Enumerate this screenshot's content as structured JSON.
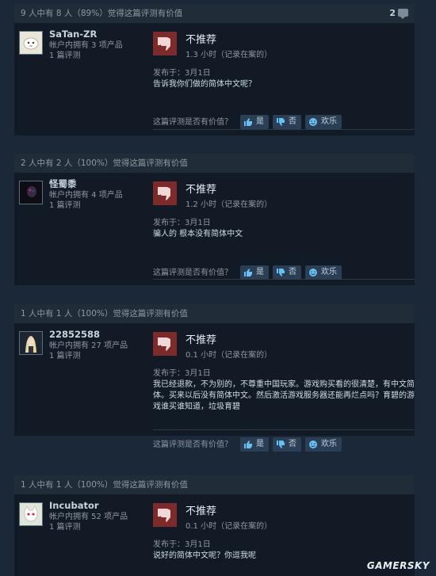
{
  "vote_labels": {
    "yes": "是",
    "no": "否",
    "funny": "欢乐"
  },
  "helpful_question": "这篇评测是否有价值？",
  "reviews": [
    {
      "helpful_summary": "9 人中有 8 人（89%）觉得这篇评测有价值",
      "comment_count": "2",
      "user_name": "SaTan-ZR",
      "products": "帐户内拥有 3 项产品",
      "review_count": "1 篇评测",
      "verdict": "不推荐",
      "hours": "1.3 小时（记录在案的）",
      "posted": "发布于：3月1日",
      "text": "告诉我你们做的简体中文呢？",
      "avatar_icon": "sheep-avatar-icon"
    },
    {
      "helpful_summary": "2 人中有 2 人（100%）觉得这篇评测有价值",
      "comment_count": "",
      "user_name": "怪蜀黍",
      "products": "帐户内拥有 4 项产品",
      "review_count": "1 篇评测",
      "verdict": "不推荐",
      "hours": "1.2 小时（记录在案的）",
      "posted": "发布于：3月1日",
      "text": "骗人的 根本没有简体中文",
      "avatar_icon": "dark-creature-avatar-icon"
    },
    {
      "helpful_summary": "1 人中有 1 人（100%）觉得这篇评测有价值",
      "comment_count": "",
      "user_name": "22852588",
      "products": "帐户内拥有 27 项产品",
      "review_count": "1 篇评测",
      "verdict": "不推荐",
      "hours": "0.1 小时（记录在案的）",
      "posted": "发布于：3月1日",
      "text": "我已经退款，不为别的，不尊重中国玩家。游戏购买看的很清楚，有中文简体。买来以后没有简体中文。然后激活游戏服务器还能再烂点吗？育碧的游戏谁买谁知道，垃圾育碧",
      "avatar_icon": "blonde-character-avatar-icon"
    },
    {
      "helpful_summary": "1 人中有 1 人（100%）觉得这篇评测有价值",
      "comment_count": "",
      "user_name": "Incubator",
      "products": "帐户内拥有 52 项产品",
      "review_count": "1 篇评测",
      "verdict": "不推荐",
      "hours": "0.1 小时（记录在案的）",
      "posted": "发布于：3月1日",
      "text": "说好的简体中文呢？你逗我呢",
      "avatar_icon": "white-cat-avatar-icon"
    }
  ],
  "watermark": "GAMERSKY",
  "colors": {
    "background": "#1b2838",
    "thumb_down": "#7c2a2a",
    "button": "#2a3f56"
  }
}
